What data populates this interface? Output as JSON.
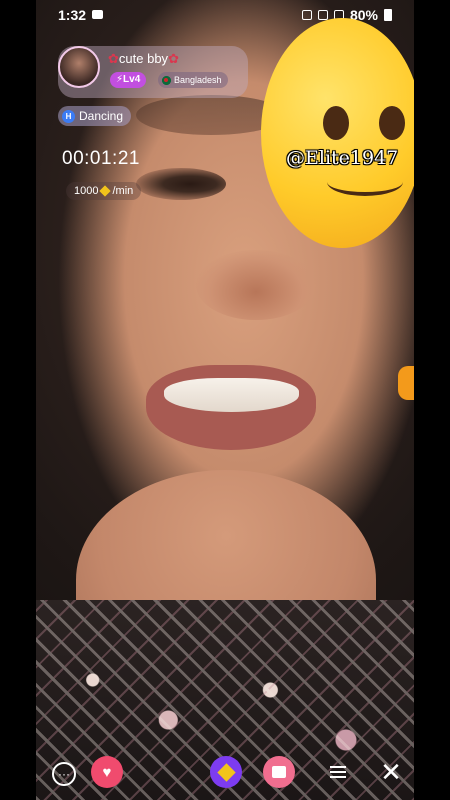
{
  "status_bar": {
    "time": "1:32",
    "battery": "80%"
  },
  "host": {
    "name": "cute bby",
    "level": "Lv4",
    "country": "Bangladesh"
  },
  "tag": {
    "label": "Dancing",
    "badge": "H"
  },
  "timer": "00:01:21",
  "rate": {
    "amount": "1000",
    "unit": "/min"
  },
  "watermark": "@Elite1947",
  "icons": [
    "chat-icon",
    "heart-icon",
    "diamond-icon",
    "gift-icon",
    "menu-icon",
    "close-icon"
  ]
}
